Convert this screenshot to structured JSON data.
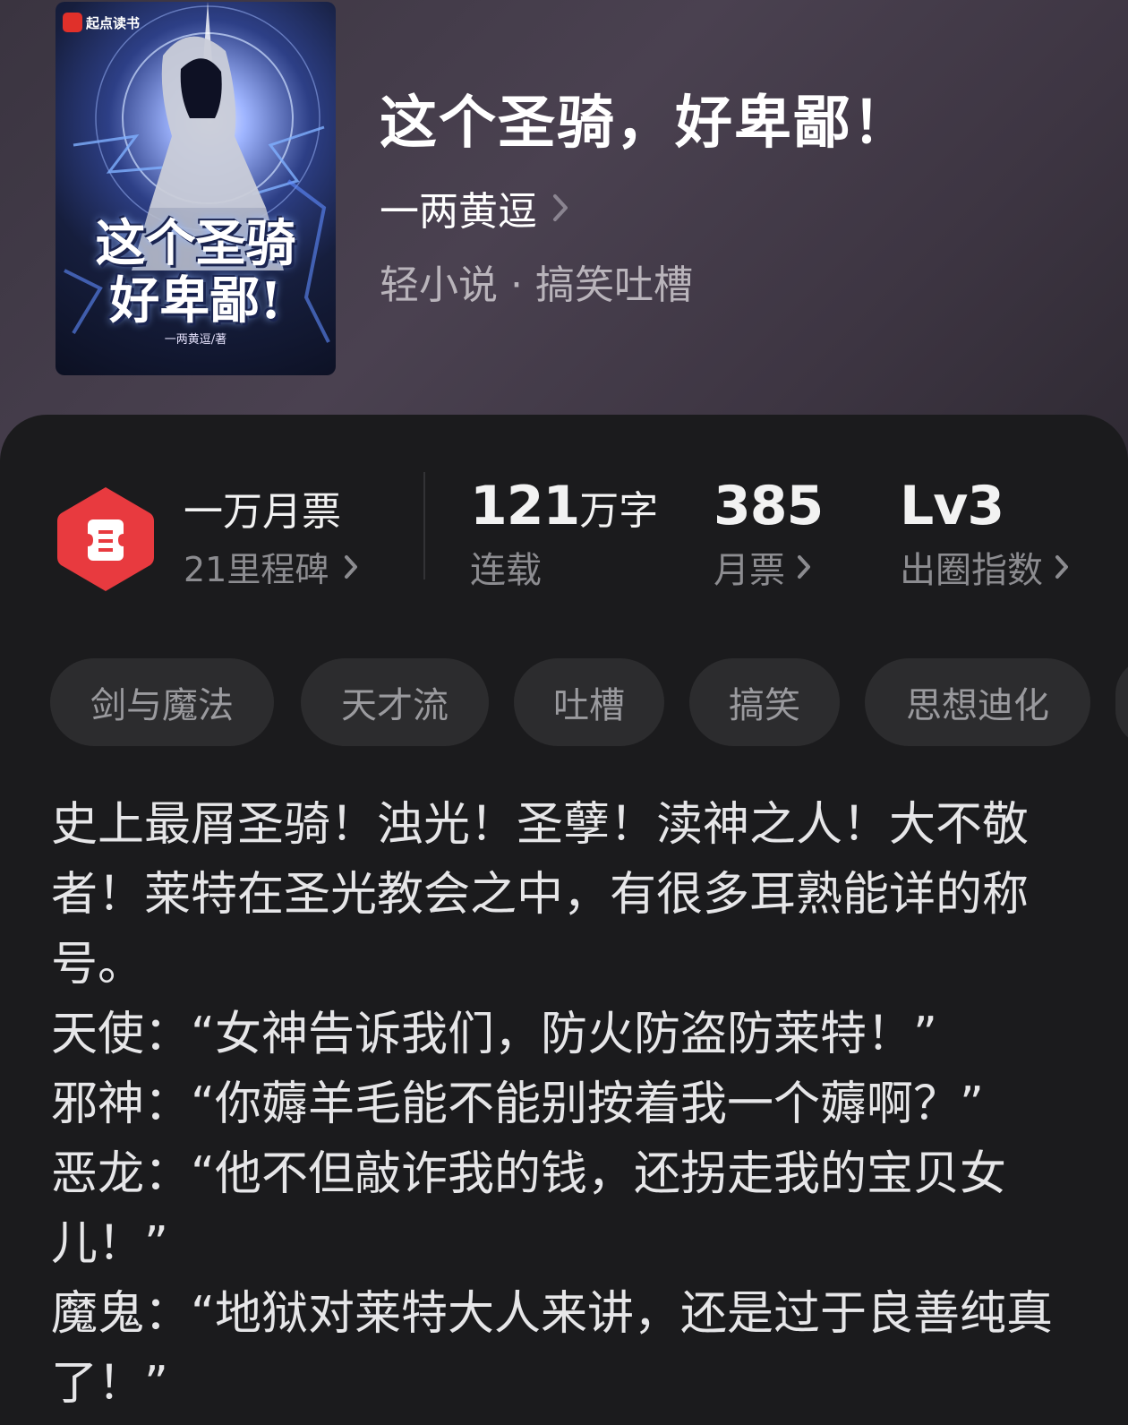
{
  "book": {
    "title": "这个圣骑，好卑鄙！",
    "author": "一两黄逗",
    "genre_line": "轻小说 · 搞笑吐槽"
  },
  "cover": {
    "brand": "起点读书",
    "title_line1": "这个圣骑",
    "title_line2": "好卑鄙!",
    "author_credit": "一两黄逗/著"
  },
  "stats": {
    "milestone_title": "一万月票",
    "milestone_sub": "21里程碑",
    "words_value": "121",
    "words_unit": "万字",
    "words_label": "连载",
    "tickets_value": "385",
    "tickets_label": "月票",
    "circle_value": "Lv3",
    "circle_label": "出圈指数"
  },
  "tags": [
    "剑与魔法",
    "天才流",
    "吐槽",
    "搞笑",
    "思想迪化"
  ],
  "description": [
    "史上最屑圣骑！浊光！圣孽！渎神之人！大不敬者！莱特在圣光教会之中，有很多耳熟能详的称号。",
    "天使：“女神告诉我们，防火防盗防莱特！”",
    "邪神：“你薅羊毛能不能别按着我一个薅啊？”",
    "恶龙：“他不但敲诈我的钱，还拐走我的宝贝女儿！”",
    "魔鬼：“地狱对莱特大人来讲，还是过于良善纯真了！”"
  ],
  "colors": {
    "accent_red": "#e83a3f",
    "panel_bg": "#1b1b1d",
    "tag_bg": "#2c2c2e"
  }
}
